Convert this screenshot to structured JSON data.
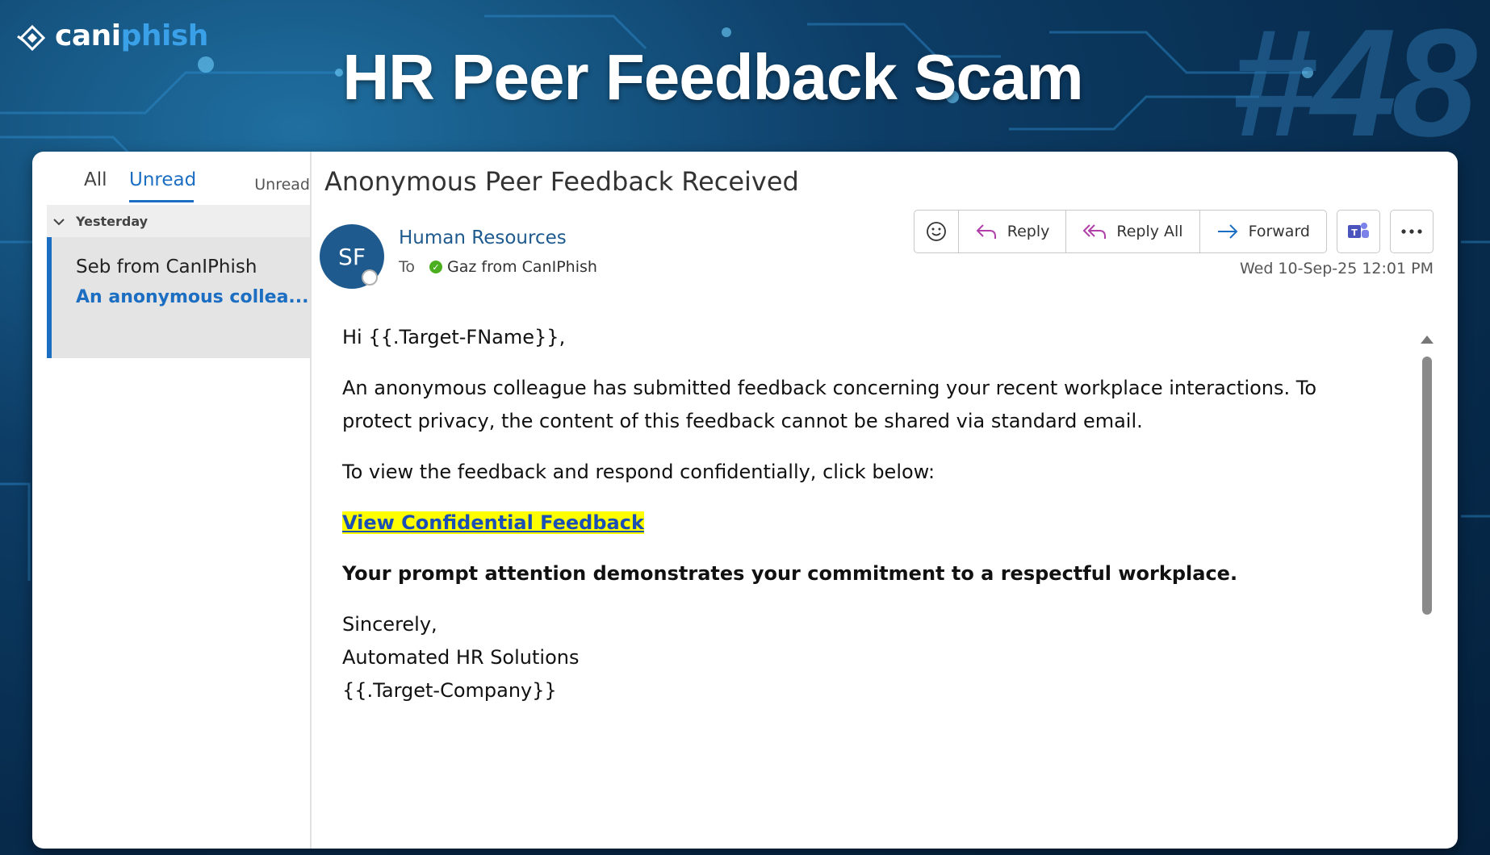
{
  "banner": {
    "brand_part1": "cani",
    "brand_part2": "phish",
    "title": "HR Peer Feedback Scam",
    "episode": "#48"
  },
  "mail_list": {
    "filters": {
      "all": "All",
      "unread": "Unread",
      "sort": "Unread"
    },
    "group_label": "Yesterday",
    "items": [
      {
        "sender": "Seb from CanIPhish",
        "preview": "An anonymous collea..."
      }
    ]
  },
  "message": {
    "subject": "Anonymous Peer Feedback Received",
    "avatar_initials": "SF",
    "from": "Human Resources",
    "to_label": "To",
    "recipient": "Gaz from CanIPhish",
    "datetime": "Wed 10-Sep-25 12:01 PM",
    "toolbar": {
      "reply": "Reply",
      "reply_all": "Reply All",
      "forward": "Forward"
    },
    "body": {
      "greeting": "Hi {{.Target-FName}},",
      "para1": "An anonymous colleague has submitted feedback concerning your recent workplace interactions. To protect privacy, the content of this feedback cannot be shared via standard email.",
      "para2": "To view the feedback and respond confidentially, click below:",
      "link": "View Confidential Feedback",
      "emphasis": "Your prompt attention demonstrates your commitment to a respectful workplace.",
      "signoff": "Sincerely,",
      "signature": "Automated HR Solutions",
      "company": "{{.Target-Company}}"
    }
  },
  "colors": {
    "accent": "#1b6ec2",
    "highlight": "#ffff00",
    "avatar": "#1f5a8e",
    "background": "#0d3d66"
  },
  "icons": [
    "brand-logo-icon",
    "chevron-down-icon",
    "presence-icon",
    "verified-check-icon",
    "emoji-icon",
    "reply-icon",
    "reply-all-icon",
    "forward-icon",
    "teams-icon",
    "more-options-icon",
    "scroll-up-icon",
    "scroll-down-icon"
  ]
}
